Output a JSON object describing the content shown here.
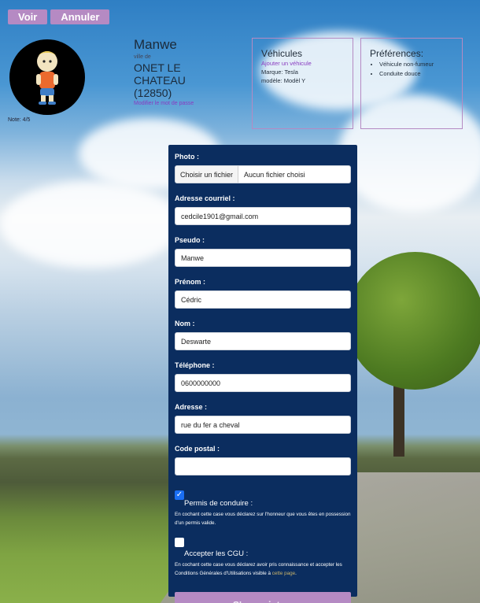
{
  "top_buttons": {
    "voir": "Voir",
    "annuler": "Annuler"
  },
  "profile": {
    "name": "Manwe",
    "ville_label": "ville de",
    "city": "ONET LE CHATEAU (12850)",
    "change_password": "Modifier le mot de passe",
    "note": "Note: 4/5"
  },
  "vehicles": {
    "title": "Véhicules",
    "add_link": "Ajouter un véhicule",
    "brand": "Marque: Tesla",
    "model": "modèle: Modèl Y"
  },
  "preferences": {
    "title": "Préférences:",
    "items": [
      "Véhicule non-fumeur",
      "Conduite douce"
    ]
  },
  "form": {
    "photo_label": "Photo :",
    "photo_button": "Choisir un fichier",
    "photo_status": "Aucun fichier choisi",
    "email_label": "Adresse courriel :",
    "email_value": "cedcile1901@gmail.com",
    "pseudo_label": "Pseudo :",
    "pseudo_value": "Manwe",
    "prenom_label": "Prénom :",
    "prenom_value": "Cédric",
    "nom_label": "Nom :",
    "nom_value": "Deswarte",
    "tel_label": "Téléphone :",
    "tel_value": "0600000000",
    "adresse_label": "Adresse :",
    "adresse_value": "rue du fer a cheval",
    "cp_label": "Code postal :",
    "cp_value": "",
    "permis_label": "Permis de conduire :",
    "permis_desc": "En cochant cette case vous déclarez sur l'honneur que vous êtes en possession d'un permis valide.",
    "permis_checked": true,
    "cgu_label": "Accepter les CGU :",
    "cgu_desc": "En cochant cette case vous déclarez avoir pris connaissance et accepter les Conditions Générales d'Utilisations visible à",
    "cgu_link": "cette page",
    "cgu_checked": false,
    "submit": "S'enregistrer"
  },
  "colors": {
    "accent": "#b58ac3",
    "form_bg": "#0b2d5f",
    "link": "#8a3cc0",
    "checkbox": "#1a6ef2"
  }
}
